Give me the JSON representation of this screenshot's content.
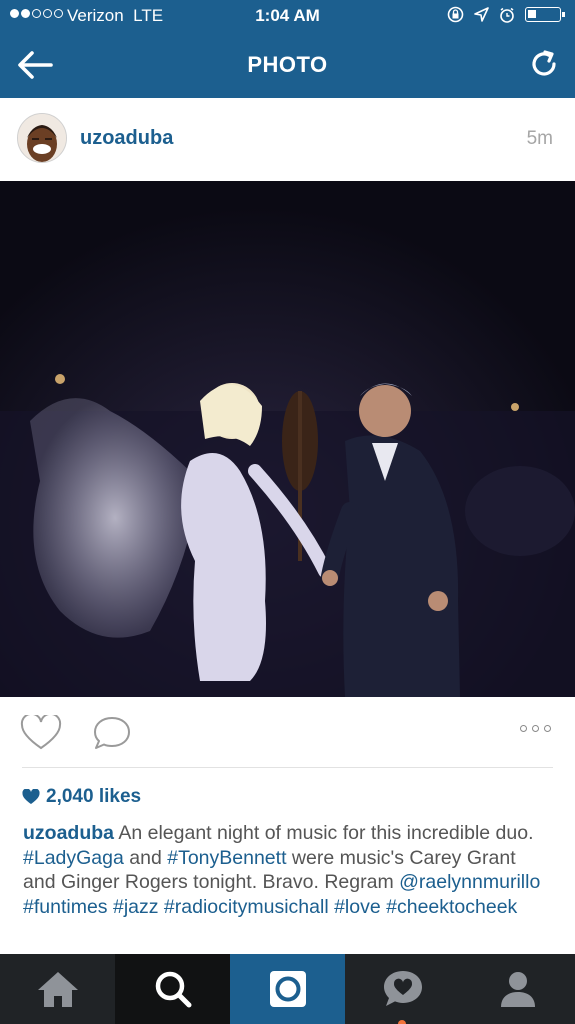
{
  "status_bar": {
    "carrier": "Verizon",
    "network": "LTE",
    "time": "1:04 AM"
  },
  "nav": {
    "title": "PHOTO",
    "back_icon": "arrow-left-icon",
    "refresh_icon": "refresh-icon"
  },
  "post": {
    "username": "uzoaduba",
    "timestamp": "5m",
    "photo_icon": "stage-photo"
  },
  "likes": {
    "text": "2,040 likes"
  },
  "caption": {
    "username": "uzoaduba",
    "t1": "An elegant night of music for this incredible duo.",
    "tag1": "#LadyGaga",
    "t2": "and",
    "tag2": "#TonyBennett",
    "t3": "were music's Carey Grant and Ginger Rogers tonight. Bravo. Regram",
    "mention": "@raelynnmurillo",
    "tag3": "#funtimes",
    "tag4": "#jazz",
    "tag5": "#radiocitymusichall",
    "tag6": "#love",
    "tag7": "#cheektocheek"
  },
  "colors": {
    "brand": "#1c5f8f",
    "tabbar": "#202326",
    "notification": "#f2733a"
  },
  "tabs": [
    {
      "icon": "home-icon"
    },
    {
      "icon": "search-icon"
    },
    {
      "icon": "camera-icon"
    },
    {
      "icon": "activity-icon"
    },
    {
      "icon": "profile-icon"
    }
  ]
}
